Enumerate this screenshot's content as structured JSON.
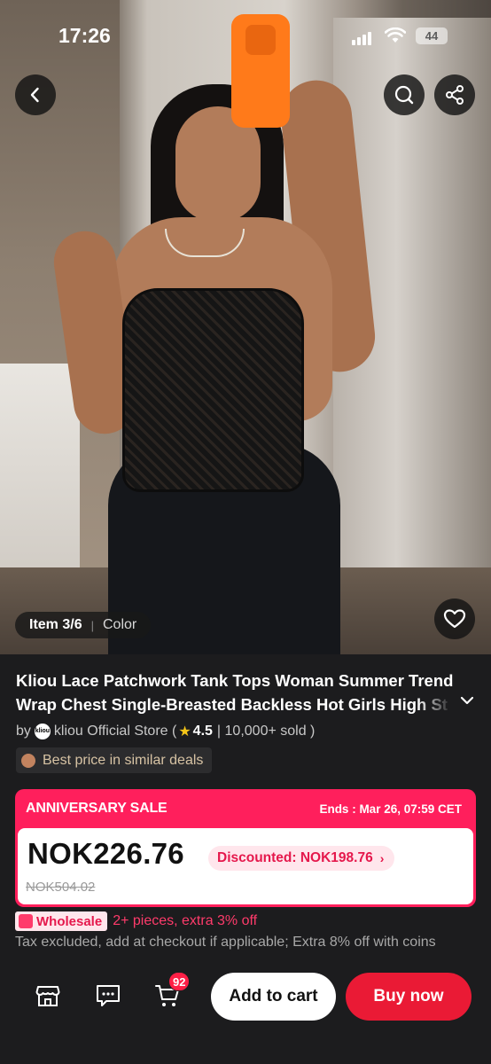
{
  "status_bar": {
    "time": "17:26",
    "battery": "44"
  },
  "hero": {
    "photo_icon": "product-photo"
  },
  "gallery": {
    "item_counter": "Item 3/6",
    "separator": "|",
    "color_label": "Color"
  },
  "product": {
    "title_line1": "Kliou Lace Patchwork Tank Tops Woman Summer Trend",
    "title_line2": "Wrap Chest Single-Breasted Backless Hot Girls High St",
    "store_prefix": "by",
    "store_logo_text": "kliou",
    "store_name": "kliou Official Store (",
    "rating": "4.5",
    "sold": "| 10,000+ sold )",
    "best_price": "Best price in similar deals"
  },
  "sale": {
    "banner": "ANNIVERSARY SALE",
    "ends": "Ends : Mar 26, 07:59 CET",
    "price": "NOK226.76",
    "discounted": "Discounted: NOK198.76",
    "original_price": "NOK504.02",
    "accent": "#ff1f5c"
  },
  "wholesale": {
    "badge": "Wholesale",
    "text": "2+ pieces, extra 3% off"
  },
  "tax_note": "Tax excluded, add at checkout if applicable; Extra 8% off with coins",
  "bottom_bar": {
    "cart_count": "92",
    "add_to_cart": "Add to cart",
    "buy_now": "Buy now",
    "buy_color": "#ea1a35"
  },
  "icons": [
    "back-icon",
    "search-icon",
    "share-icon",
    "heart-icon",
    "store-icon",
    "message-icon",
    "cart-icon",
    "chevron-down-icon",
    "star-icon",
    "tag-icon"
  ]
}
